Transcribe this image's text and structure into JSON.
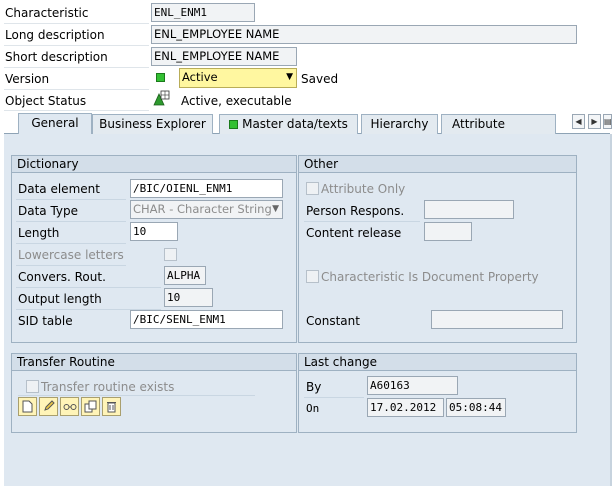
{
  "header": {
    "characteristic_label": "Characteristic",
    "characteristic_value": "ENL_ENM1",
    "long_desc_label": "Long description",
    "long_desc_value": "ENL_EMPLOYEE NAME",
    "short_desc_label": "Short description",
    "short_desc_value": "ENL_EMPLOYEE NAME",
    "version_label": "Version",
    "version_value": "Active",
    "version_status": "Saved",
    "object_status_label": "Object Status",
    "object_status_value": "Active, executable"
  },
  "tabs": {
    "general": "General",
    "business_explorer": "Business Explorer",
    "master_data": "Master data/texts",
    "hierarchy": "Hierarchy",
    "attribute": "Attribute"
  },
  "dictionary": {
    "title": "Dictionary",
    "data_element_label": "Data element",
    "data_element_value": "/BIC/OIENL_ENM1",
    "data_type_label": "Data Type",
    "data_type_value": "CHAR - Character String",
    "length_label": "Length",
    "length_value": "10",
    "lowercase_label": "Lowercase letters",
    "convers_label": "Convers. Rout.",
    "convers_value": "ALPHA",
    "output_length_label": "Output length",
    "output_length_value": "10",
    "sid_table_label": "SID table",
    "sid_table_value": "/BIC/SENL_ENM1"
  },
  "other": {
    "title": "Other",
    "attribute_only_label": "Attribute Only",
    "person_respons_label": "Person Respons.",
    "content_release_label": "Content release",
    "doc_property_label": "Characteristic Is Document Property",
    "constant_label": "Constant"
  },
  "transfer": {
    "title": "Transfer Routine",
    "exists_label": "Transfer routine exists"
  },
  "last_change": {
    "title": "Last change",
    "by_label": "By",
    "by_value": "A60163",
    "on_label": "On",
    "date_value": "17.02.2012",
    "time_value": "05:08:44"
  },
  "colors": {
    "accent_green": "#33c033",
    "version_field": "#fff7a0",
    "panel_bg": "#dfe8f1"
  }
}
